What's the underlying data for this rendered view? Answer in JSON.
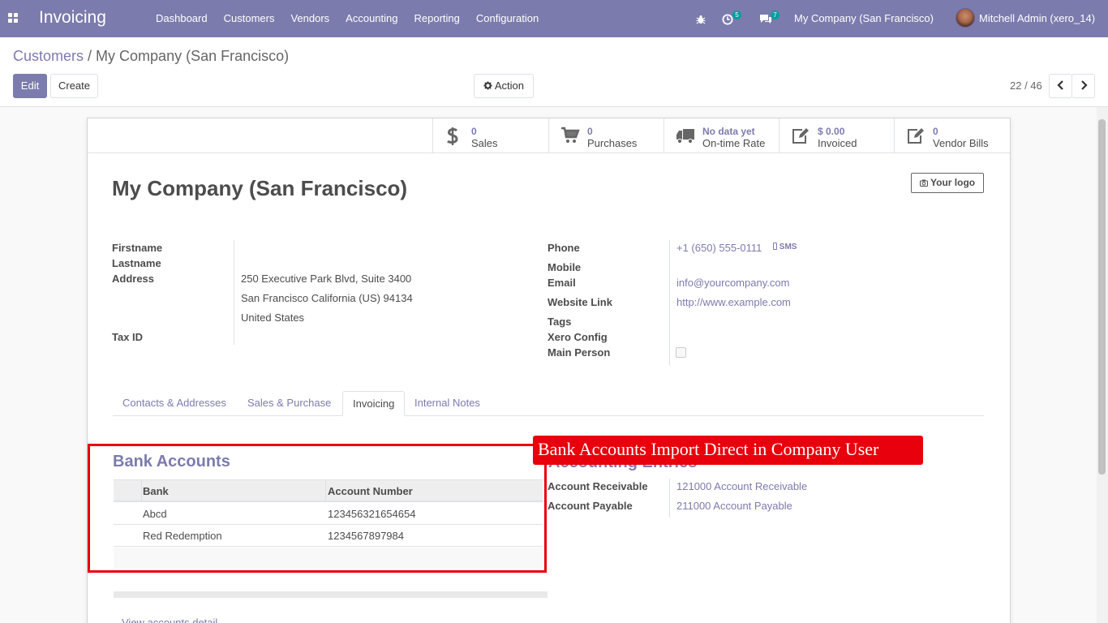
{
  "navbar": {
    "app_title": "Invoicing",
    "menu": [
      "Dashboard",
      "Customers",
      "Vendors",
      "Accounting",
      "Reporting",
      "Configuration"
    ],
    "activity_count": "5",
    "message_count": "7",
    "company": "My Company (San Francisco)",
    "user": "Mitchell Admin (xero_14)",
    "color": "#7c7bad"
  },
  "breadcrumb": {
    "parent": "Customers",
    "separator": "/",
    "current": "My Company (San Francisco)"
  },
  "toolbar": {
    "edit": "Edit",
    "create": "Create",
    "action": "Action"
  },
  "pager": {
    "value": "22 / 46"
  },
  "smart_buttons": [
    {
      "value": "0",
      "label": "Sales",
      "icon": "dollar-icon"
    },
    {
      "value": "0",
      "label": "Purchases",
      "icon": "cart-icon"
    },
    {
      "value": "No data yet",
      "label": "On-time Rate",
      "icon": "truck-icon"
    },
    {
      "value": "$ 0.00",
      "label": "Invoiced",
      "icon": "edit-icon"
    },
    {
      "value": "0",
      "label": "Vendor Bills",
      "icon": "edit-icon"
    }
  ],
  "record": {
    "name": "My Company (San Francisco)",
    "logo_button": "Your logo"
  },
  "left_fields": {
    "firstname_label": "Firstname",
    "lastname_label": "Lastname",
    "address_label": "Address",
    "address_line1": "250 Executive Park Blvd, Suite 3400",
    "address_line2": "San Francisco  California (US)  94134",
    "address_line3": "United States",
    "tax_label": "Tax ID"
  },
  "right_fields": {
    "phone_label": "Phone",
    "phone": "+1 (650) 555-0111",
    "sms": "SMS",
    "mobile_label": "Mobile",
    "email_label": "Email",
    "email": "info@yourcompany.com",
    "website_label": "Website Link",
    "website": "http://www.example.com",
    "tags_label": "Tags",
    "xero_label": "Xero Config",
    "main_person_label": "Main Person",
    "main_person_checked": false
  },
  "tabs": [
    "Contacts & Addresses",
    "Sales & Purchase",
    "Invoicing",
    "Internal Notes"
  ],
  "active_tab": "Invoicing",
  "bank_accounts": {
    "title": "Bank Accounts",
    "columns": [
      "Bank",
      "Account Number"
    ],
    "rows": [
      {
        "bank": "Abcd",
        "account": "123456321654654"
      },
      {
        "bank": "Red Redemption",
        "account": "1234567897984"
      }
    ]
  },
  "accounting_entries": {
    "title": "Accounting Entries",
    "receivable_label": "Account Receivable",
    "receivable": "121000 Account Receivable",
    "payable_label": "Account Payable",
    "payable": "211000 Account Payable"
  },
  "callout": {
    "text": "Bank Accounts Import Direct in Company User",
    "color": "#e8000c"
  },
  "footer_link": "View accounts detail"
}
